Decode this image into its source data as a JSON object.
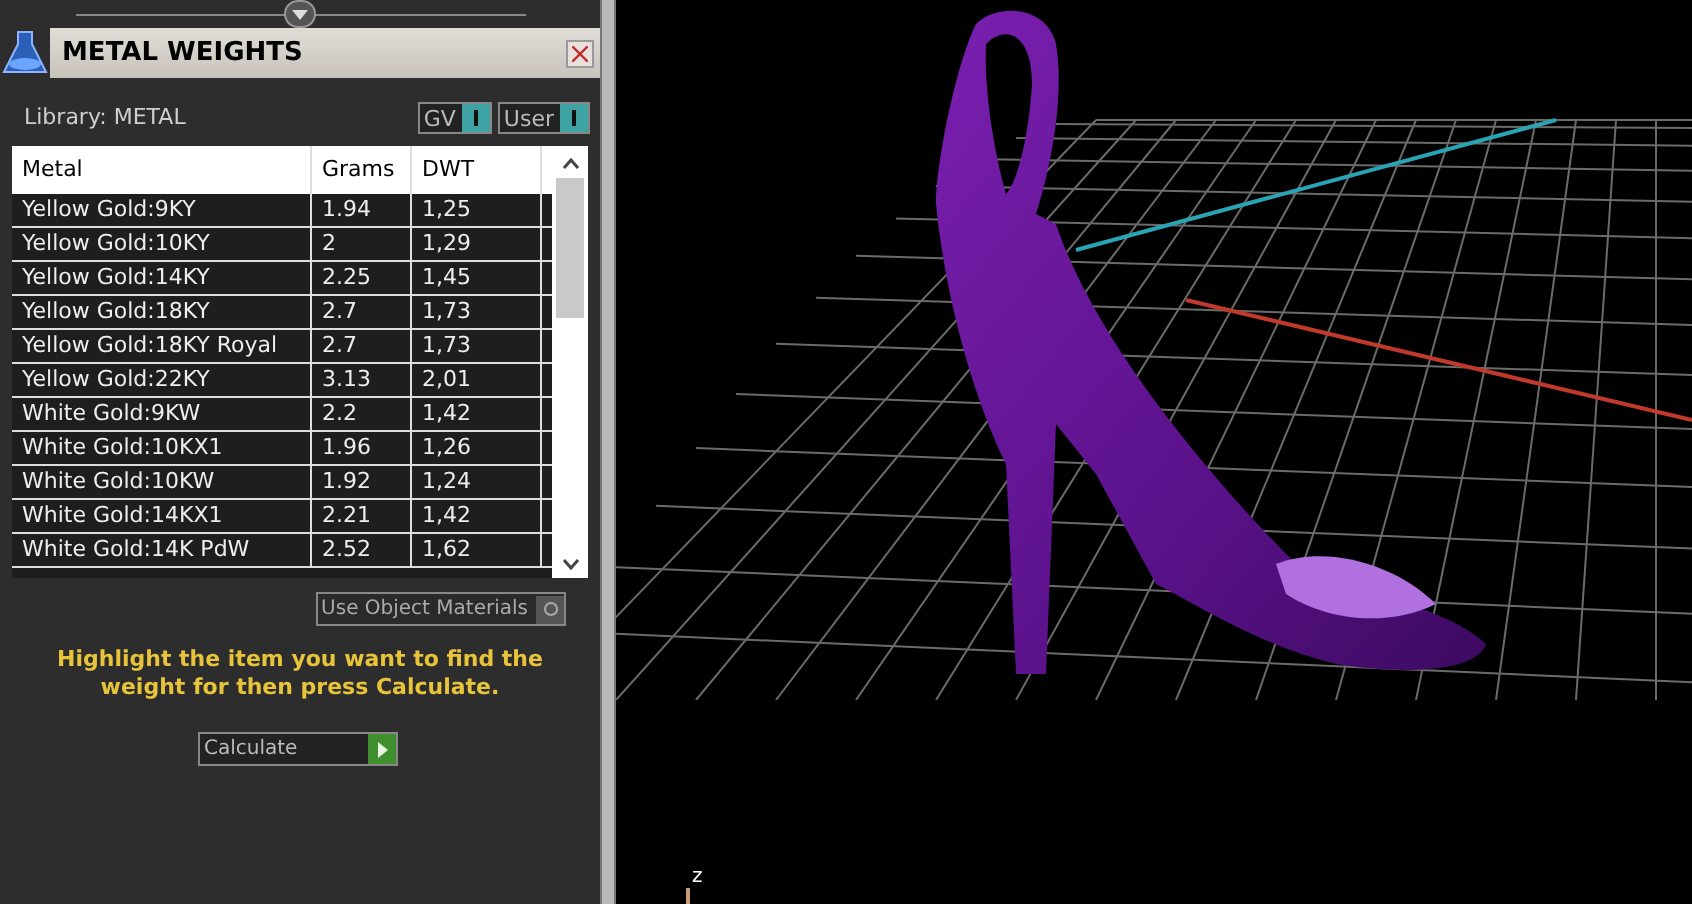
{
  "panel": {
    "title": "METAL WEIGHTS",
    "library_label": "Library: METAL",
    "toggles": [
      {
        "label": "GV",
        "on": true
      },
      {
        "label": "User",
        "on": true
      }
    ],
    "table": {
      "columns": [
        "Metal",
        "Grams",
        "DWT"
      ],
      "rows": [
        [
          "Yellow Gold:9KY",
          "1.94",
          "1,25"
        ],
        [
          "Yellow Gold:10KY",
          "2",
          "1,29"
        ],
        [
          "Yellow Gold:14KY",
          "2.25",
          "1,45"
        ],
        [
          "Yellow Gold:18KY",
          "2.7",
          "1,73"
        ],
        [
          "Yellow Gold:18KY Royal",
          "2.7",
          "1,73"
        ],
        [
          "Yellow Gold:22KY",
          "3.13",
          "2,01"
        ],
        [
          "White Gold:9KW",
          "2.2",
          "1,42"
        ],
        [
          "White Gold:10KX1",
          "1.96",
          "1,26"
        ],
        [
          "White Gold:10KW",
          "1.92",
          "1,24"
        ],
        [
          "White Gold:14KX1",
          "2.21",
          "1,42"
        ],
        [
          "White Gold:14K PdW",
          "2.52",
          "1,62"
        ]
      ]
    },
    "use_object_materials": {
      "label": "Use Object Materials",
      "on": false
    },
    "hint": "Highlight the item you want to find the weight for then press Calculate.",
    "action": {
      "label": "Calculate"
    }
  },
  "viewport": {
    "axis_label": "z"
  }
}
